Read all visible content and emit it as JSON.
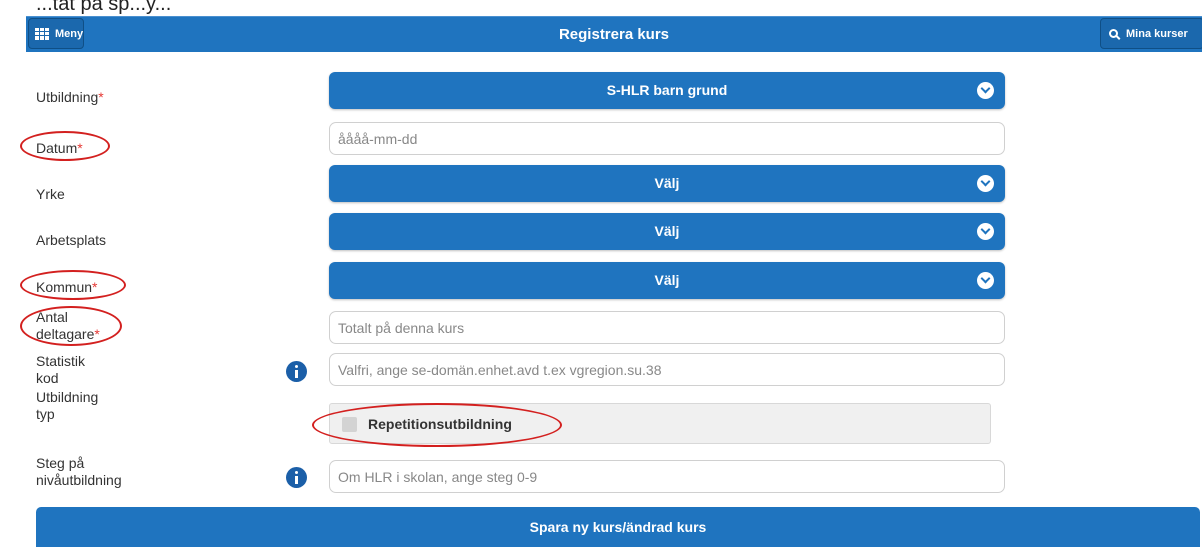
{
  "cropped_text": "...tät på sp...y...",
  "header": {
    "menu_label": "Meny",
    "title": "Registrera kurs",
    "mina_label": "Mina kurser",
    "menu_icon": "grid-icon",
    "mina_icon": "search-icon"
  },
  "form": {
    "utbildning": {
      "label": "Utbildning",
      "required": "*",
      "value": "S-HLR barn grund"
    },
    "datum": {
      "label": "Datum",
      "required": "*",
      "placeholder": "åååå-mm-dd"
    },
    "yrke": {
      "label": "Yrke",
      "value": "Välj"
    },
    "arbetsplats": {
      "label": "Arbetsplats",
      "value": "Välj"
    },
    "kommun": {
      "label": "Kommun",
      "required": "*",
      "value": "Välj"
    },
    "antal": {
      "label_line1": "Antal",
      "label_line2": "deltagare",
      "required": "*",
      "placeholder": "Totalt på denna kurs"
    },
    "statistik": {
      "label_line1": "Statistik",
      "label_line2": "kod",
      "placeholder": "Valfri, ange se-domän.enhet.avd t.ex vgregion.su.38"
    },
    "utbildning_typ": {
      "label_line1": "Utbildning",
      "label_line2": "typ",
      "checkbox_label": "Repetitionsutbildning"
    },
    "steg": {
      "label_line1": "Steg på",
      "label_line2": "nivåutbildning",
      "placeholder": "Om HLR i skolan, ange steg 0-9"
    }
  },
  "save_label": "Spara ny kurs/ändrad kurs",
  "colors": {
    "primary": "#1f74bf",
    "annotation": "#d3201f",
    "required": "#e53935"
  }
}
